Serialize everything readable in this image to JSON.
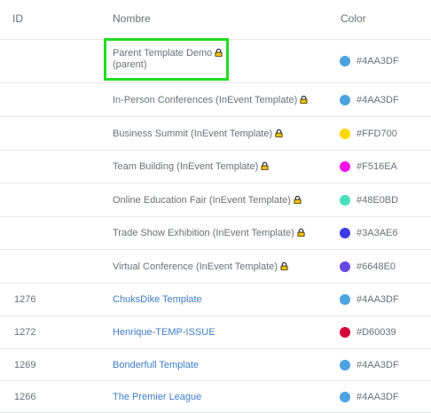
{
  "columns": {
    "id": "ID",
    "name": "Nombre",
    "color": "Color"
  },
  "rows": [
    {
      "id": "",
      "name": "Parent Template Demo",
      "sub": "(parent)",
      "locked": true,
      "link": false,
      "swatch": "#4AA3DF",
      "hex": "#4AA3DF"
    },
    {
      "id": "",
      "name": "In-Person Conferences (InEvent Template)",
      "locked": true,
      "link": false,
      "swatch": "#4AA3DF",
      "hex": "#4AA3DF"
    },
    {
      "id": "",
      "name": "Business Summit (InEvent Template)",
      "locked": true,
      "link": false,
      "swatch": "#FFD700",
      "hex": "#FFD700"
    },
    {
      "id": "",
      "name": "Team Building (InEvent Template)",
      "locked": true,
      "link": false,
      "swatch": "#F516EA",
      "hex": "#F516EA"
    },
    {
      "id": "",
      "name": "Online Education Fair (InEvent Template)",
      "locked": true,
      "link": false,
      "swatch": "#48E0BD",
      "hex": "#48E0BD"
    },
    {
      "id": "",
      "name": "Trade Show Exhibition (InEvent Template)",
      "locked": true,
      "link": false,
      "swatch": "#3A3AE6",
      "hex": "#3A3AE6"
    },
    {
      "id": "",
      "name": "Virtual Conference (InEvent Template)",
      "locked": true,
      "link": false,
      "swatch": "#6648E0",
      "hex": "#6648E0"
    },
    {
      "id": "1276",
      "name": "ChuksDike Template",
      "locked": false,
      "link": true,
      "swatch": "#4AA3DF",
      "hex": "#4AA3DF"
    },
    {
      "id": "1272",
      "name": "Henrique-TEMP-ISSUE",
      "locked": false,
      "link": true,
      "swatch": "#D60039",
      "hex": "#D60039"
    },
    {
      "id": "1269",
      "name": "Bonderfull Template",
      "locked": false,
      "link": true,
      "swatch": "#4AA3DF",
      "hex": "#4AA3DF"
    },
    {
      "id": "1266",
      "name": "The Premier League",
      "locked": false,
      "link": true,
      "swatch": "#4AA3DF",
      "hex": "#4AA3DF"
    }
  ],
  "highlight_color": "#22DD22",
  "lock_icon": "lock-icon"
}
